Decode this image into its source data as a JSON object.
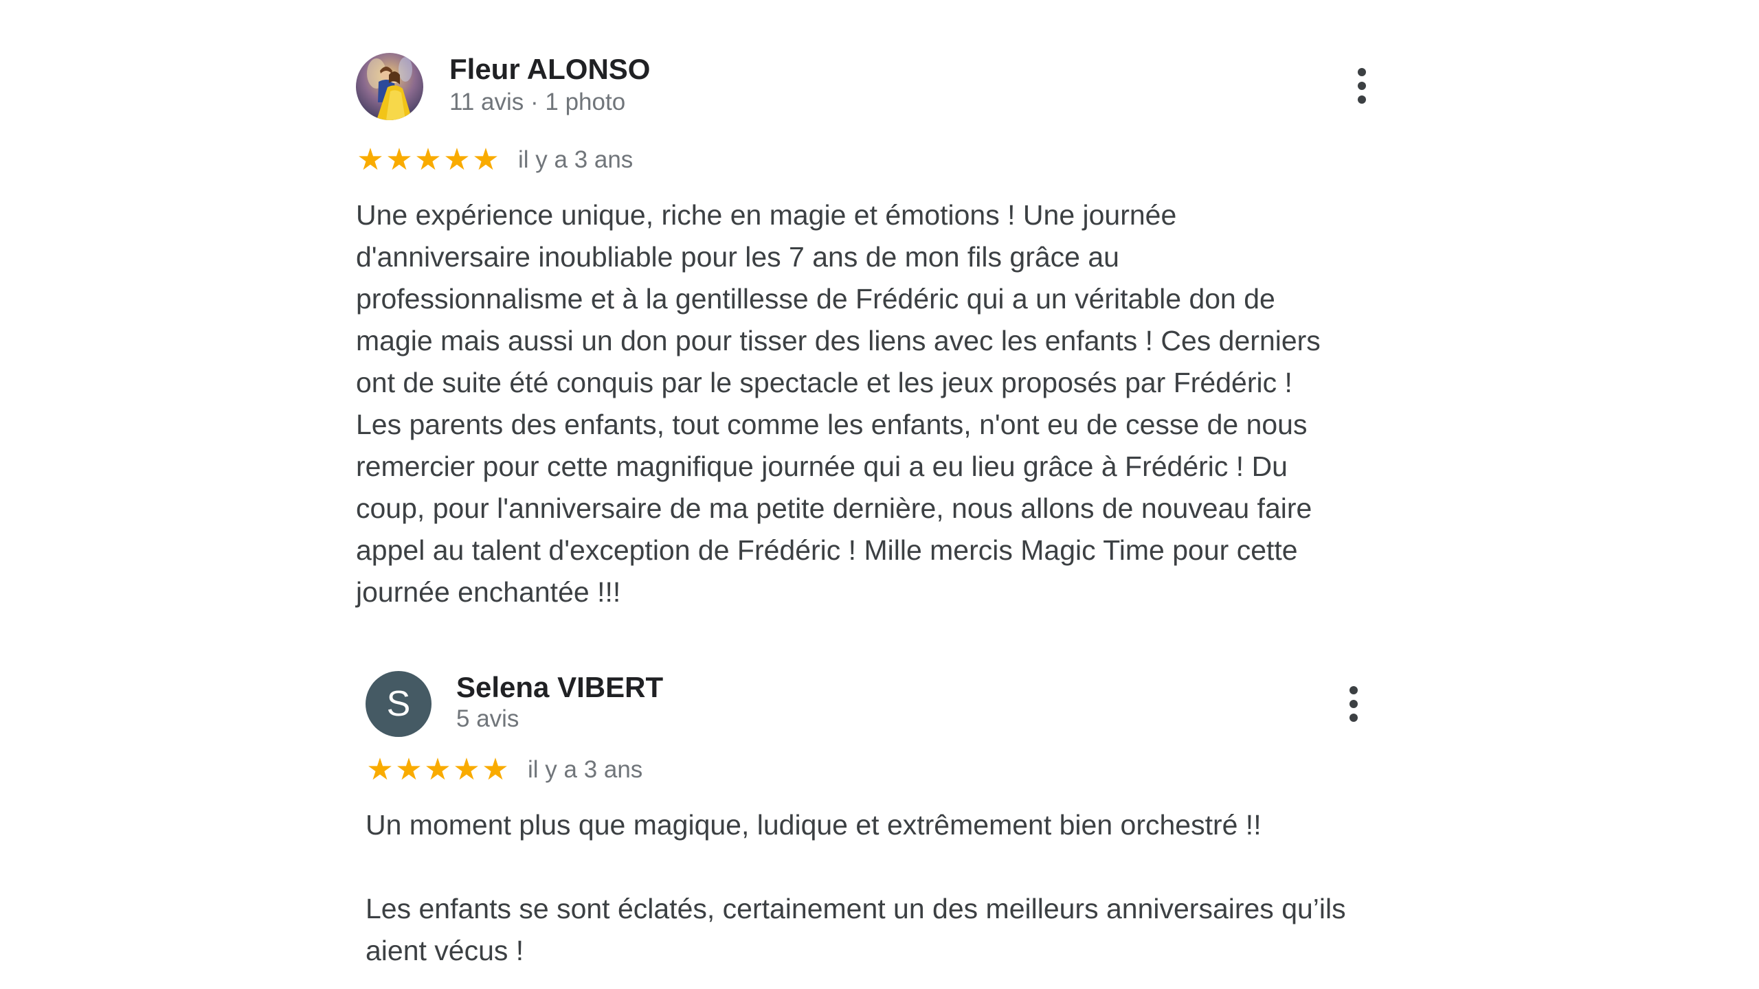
{
  "colors": {
    "star": "#f9ab00",
    "text": "#3c4043",
    "muted": "#70757a",
    "avatar_letter_bg": "#455a64"
  },
  "reviews": [
    {
      "author": "Fleur ALONSO",
      "meta": "11 avis · 1 photo",
      "avatar_icon": "profile-photo",
      "rating": 5,
      "date": "il y a 3 ans",
      "text": "Une expérience unique, riche en magie et émotions ! Une journée\nd'anniversaire inoubliable pour les 7 ans de mon fils grâce au\nprofessionnalisme et à la gentillesse de Frédéric qui a un véritable don de\nmagie mais aussi un don pour tisser des liens avec les enfants ! Ces derniers\nont de suite été conquis par le spectacle et les jeux proposés par Frédéric !\nLes parents des enfants, tout comme les enfants, n'ont eu de cesse de nous\nremercier pour cette magnifique journée qui a eu lieu grâce à Frédéric ! Du\ncoup, pour l'anniversaire de ma petite dernière, nous allons de nouveau faire\nappel au talent d'exception de Frédéric ! Mille mercis Magic Time pour cette\njournée enchantée !!!"
    },
    {
      "author": "Selena VIBERT",
      "meta": "5 avis",
      "avatar_letter": "S",
      "rating": 5,
      "date": "il y a 3 ans",
      "text": "Un moment plus que magique, ludique et extrêmement bien orchestré !!\n\nLes enfants se sont éclatés, certainement un des meilleurs anniversaires qu’ils\naient vécus !"
    }
  ]
}
